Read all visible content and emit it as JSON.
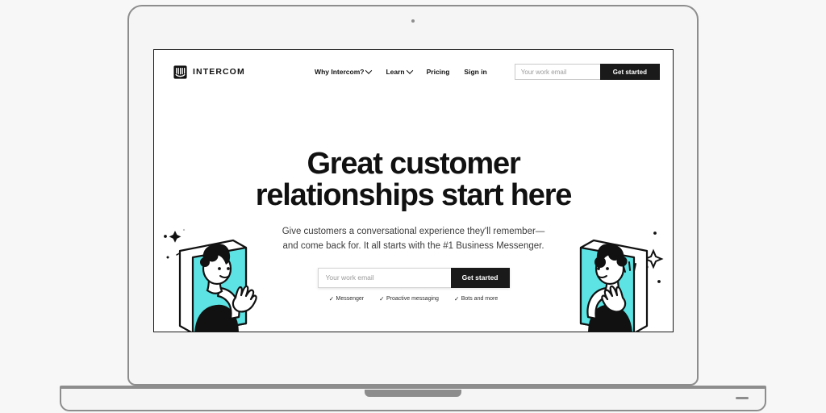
{
  "device": {
    "type": "laptop-mockup",
    "frame_color": "#8d8d8d",
    "body_color": "#f5f5f5",
    "page_background": "#f7f7f7"
  },
  "site": {
    "brand": {
      "name": "INTERCOM",
      "logo_icon": "intercom-logo-icon",
      "logo_color": "#111111"
    },
    "nav": {
      "links": [
        {
          "label": "Why Intercom?",
          "has_dropdown": true
        },
        {
          "label": "Learn",
          "has_dropdown": true
        },
        {
          "label": "Pricing",
          "has_dropdown": false
        },
        {
          "label": "Sign in",
          "has_dropdown": false
        }
      ],
      "email": {
        "value": "",
        "placeholder": "Your work email"
      },
      "cta_label": "Get started"
    },
    "hero": {
      "title_line1": "Great customer",
      "title_line2": "relationships start here",
      "subtitle_line1": "Give customers a conversational experience they'll remember—",
      "subtitle_line2": "and come back for. It all starts with the #1 Business Messenger.",
      "email": {
        "value": "",
        "placeholder": "Your work email"
      },
      "cta_label": "Get started",
      "features": [
        {
          "check": "✓",
          "label": "Messenger"
        },
        {
          "check": "✓",
          "label": "Proactive messaging"
        },
        {
          "check": "✓",
          "label": "Bots and more"
        }
      ],
      "illustrations": {
        "left": "person-waving-from-screen-illustration",
        "right": "person-waving-from-screen-illustration",
        "accent_color": "#5de3e3",
        "ink_color": "#111111"
      }
    },
    "colors": {
      "accent": "#5de3e3",
      "text": "#111111",
      "button": "#1a1a1a",
      "muted": "#9b9b9b"
    }
  }
}
